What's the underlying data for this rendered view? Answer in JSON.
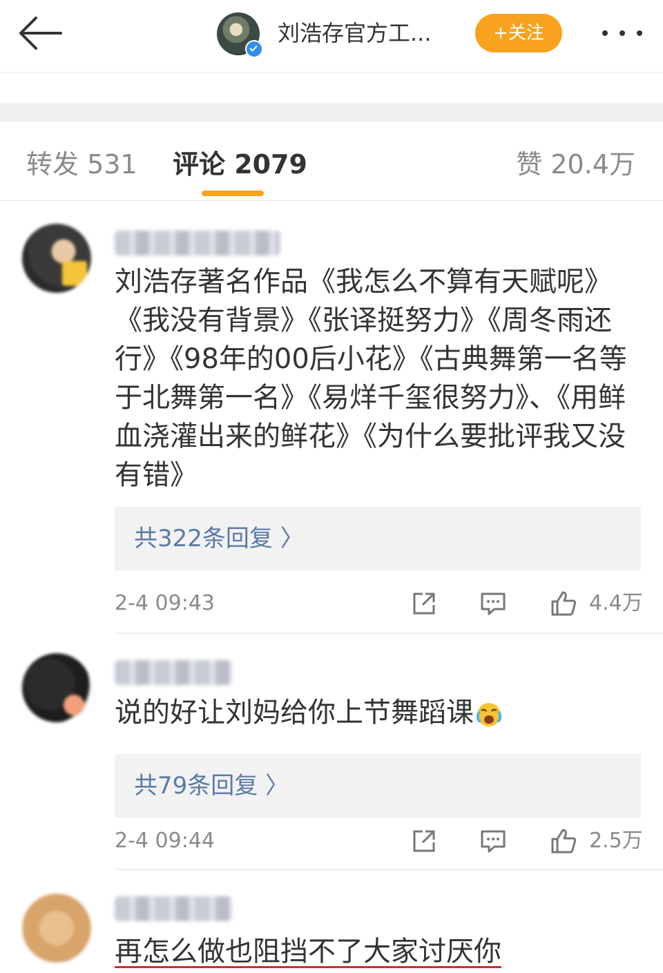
{
  "header": {
    "back_icon": "arrow-left-icon",
    "title": "刘浩存官方工...",
    "follow_label": "+关注",
    "more_icon": "more-dots-icon",
    "verified_icon": "verified-badge-icon"
  },
  "tabs": {
    "repost": "转发 531",
    "comments": "评论 2079",
    "likes": "赞 20.4万"
  },
  "comments": [
    {
      "text": "刘浩存著名作品《我怎么不算有天赋呢》《我没有背景》《张译挺努力》《周冬雨还行》《98年的00后小花》《古典舞第一名等于北舞第一名》《易烊千玺很努力》、《用鲜血浇灌出来的鲜花》《为什么要批评我又没有错》",
      "replies": "共322条回复 〉",
      "time": "2-4 09:43",
      "likes": "4.4万"
    },
    {
      "text": "说的好让刘妈给你上节舞蹈课",
      "emoji": "crying-laughing-emoji",
      "replies": "共79条回复 〉",
      "time": "2-4 09:44",
      "likes": "2.5万"
    },
    {
      "text": "再怎么做也阻挡不了大家讨厌你"
    }
  ],
  "colors": {
    "accent": "#f9a21d",
    "link": "#5a7aa6",
    "underline": "#d62b2b"
  }
}
